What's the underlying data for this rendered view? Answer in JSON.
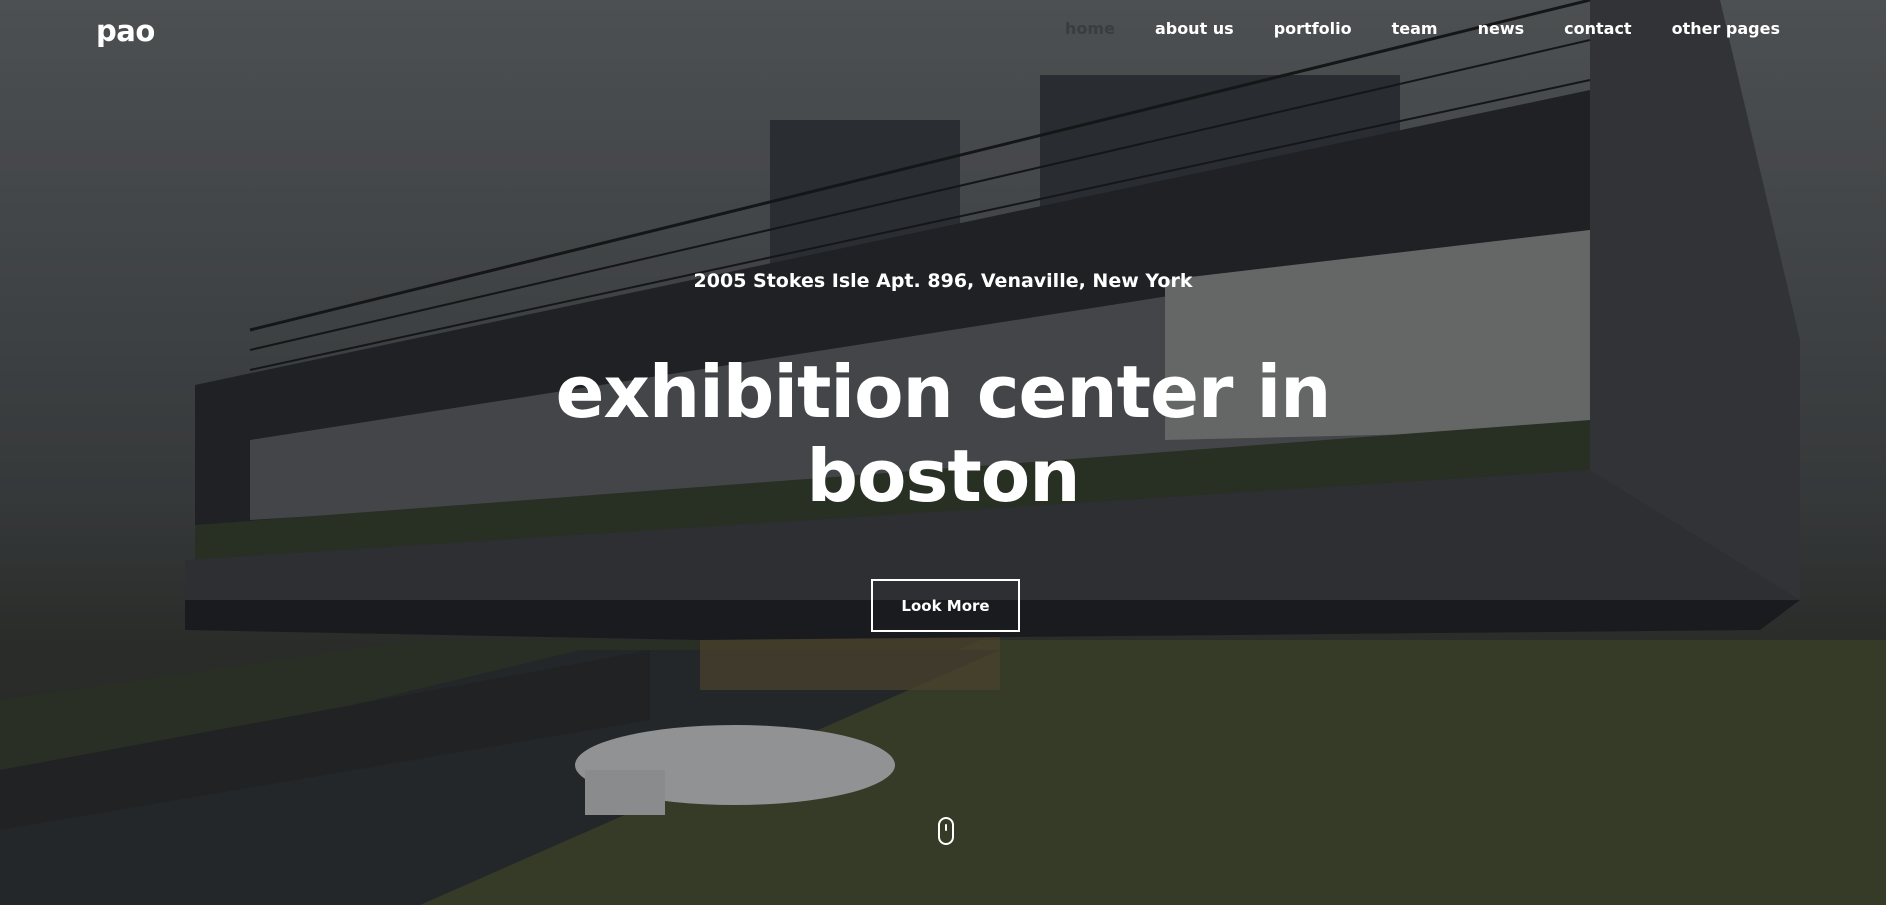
{
  "brand": {
    "logo_text": "pao"
  },
  "nav": {
    "items": [
      {
        "label": "home",
        "active": true
      },
      {
        "label": "about us",
        "active": false
      },
      {
        "label": "portfolio",
        "active": false
      },
      {
        "label": "team",
        "active": false
      },
      {
        "label": "news",
        "active": false
      },
      {
        "label": "contact",
        "active": false
      },
      {
        "label": "other pages",
        "active": false
      }
    ]
  },
  "hero": {
    "address": "2005 Stokes Isle Apt. 896, Venaville, New York",
    "headline_line1": "exhibition center in",
    "headline_line2": "boston",
    "cta_label": "Look More",
    "scroll_icon": "mouse-scroll-icon"
  },
  "colors": {
    "text": "#ffffff",
    "nav_active": "#3a3d40"
  }
}
